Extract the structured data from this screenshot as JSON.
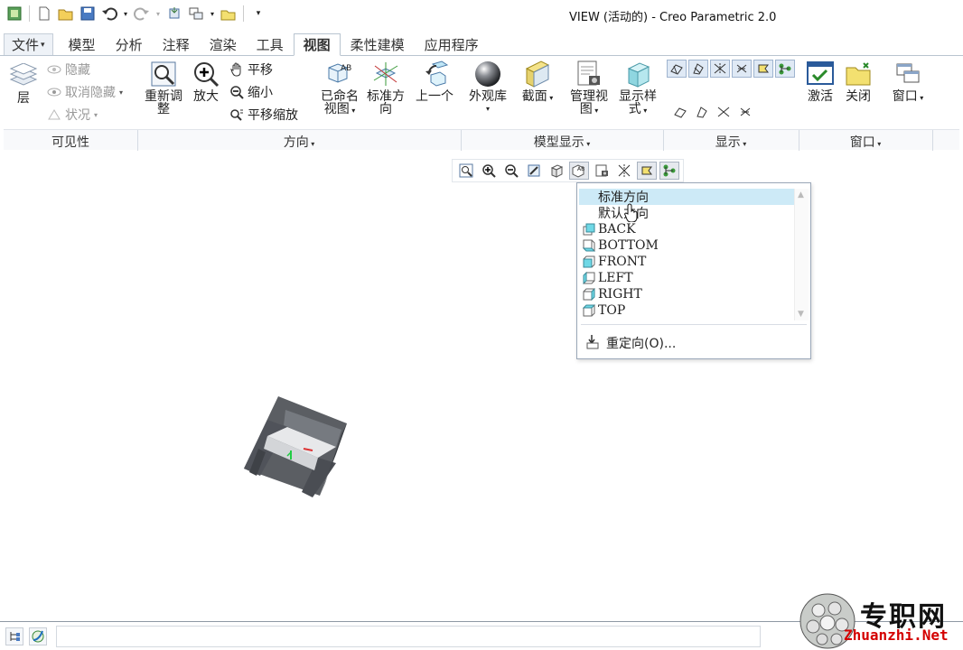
{
  "window": {
    "title": "VIEW (活动的) - Creo Parametric 2.0"
  },
  "tabs": [
    {
      "label": "文件",
      "caret": "▾"
    },
    {
      "label": "模型"
    },
    {
      "label": "分析"
    },
    {
      "label": "注释"
    },
    {
      "label": "渲染"
    },
    {
      "label": "工具"
    },
    {
      "label": "视图",
      "active": true
    },
    {
      "label": "柔性建模"
    },
    {
      "label": "应用程序"
    }
  ],
  "ribbon": {
    "visibility": {
      "layers": "层",
      "hide": "隐藏",
      "unhide": "取消隐藏",
      "status": "状况",
      "group_title": "可见性"
    },
    "orientation": {
      "refit_line1": "重新调",
      "refit_line2": "整",
      "zoom_in": "放大",
      "pan": "平移",
      "zoom_out": "缩小",
      "pan_zoom": "平移缩放",
      "named_views_line1": "已命名",
      "named_views_line2": "视图",
      "standard_line1": "标准方",
      "standard_line2": "向",
      "previous": "上一个",
      "group_title": "方向"
    },
    "model_display": {
      "appearance": "外观库",
      "section": "截面",
      "manage_line1": "管理视",
      "manage_line2": "图",
      "display_style_line1": "显示样",
      "display_style_line2": "式",
      "group_title": "模型显示"
    },
    "show": {
      "group_title": "显示"
    },
    "window": {
      "activate": "激活",
      "close": "关闭",
      "windows": "窗口",
      "group_title": "窗口"
    }
  },
  "saved_views_menu": {
    "items": [
      {
        "label": "标准方向",
        "icon": "none",
        "highlighted": true
      },
      {
        "label": "默认方向",
        "icon": "none"
      },
      {
        "label": "BACK",
        "icon": "cube-view-icon"
      },
      {
        "label": "BOTTOM",
        "icon": "cube-view-icon"
      },
      {
        "label": "FRONT",
        "icon": "cube-view-icon"
      },
      {
        "label": "LEFT",
        "icon": "cube-view-icon"
      },
      {
        "label": "RIGHT",
        "icon": "cube-view-icon"
      },
      {
        "label": "TOP",
        "icon": "cube-view-icon"
      }
    ],
    "reorient": "重定向(O)..."
  },
  "watermark": {
    "text": "专职网",
    "url": "Zhuanzhi.Net"
  },
  "colors": {
    "accent": "#3b7fd0",
    "highlight": "#cdeaf7",
    "model": "#5b5e63"
  }
}
